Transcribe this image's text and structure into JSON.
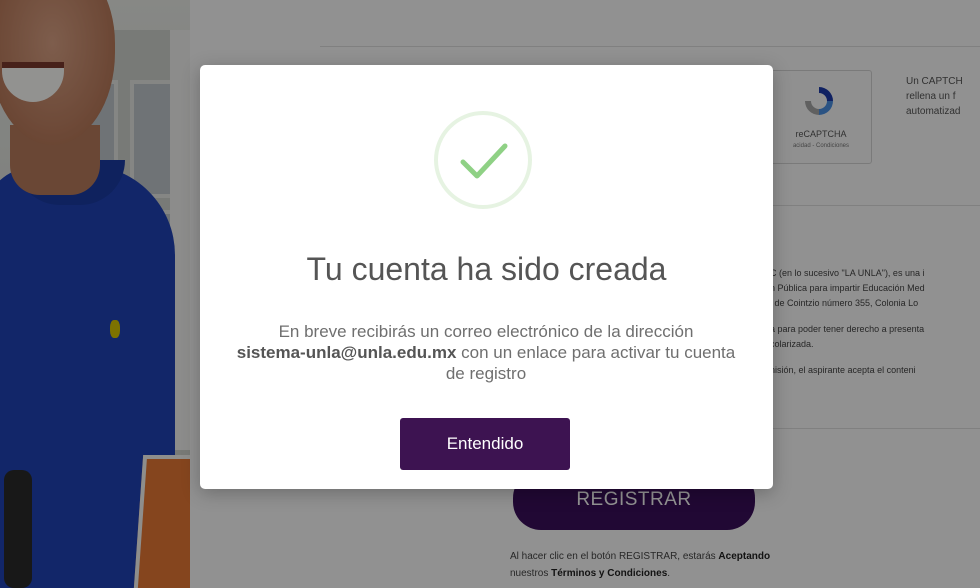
{
  "captcha": {
    "label": "reCAPTCHA",
    "sub": "acidad - Condiciones",
    "info_lines": [
      "Un CAPTCH",
      "rellena un f",
      "automatizad"
    ]
  },
  "legal": {
    "lines_1": [
      "C (en lo sucesivo \"LA UNLA\"), es una i",
      "n Pública para impartir Educación Med",
      "l de Cointzio número 355, Colonia Lo"
    ],
    "lines_2": [
      "a para poder tener derecho a presenta",
      "colarizada."
    ],
    "lines_3": [
      "nisión, el aspirante acepta el conteni"
    ]
  },
  "form": {
    "register_label": "REGISTRAR",
    "terms_prefix": "Al hacer clic en el botón REGISTRAR, estarás ",
    "terms_accept": "Aceptando",
    "terms_middle": "nuestros ",
    "terms_link": "Términos y Condiciones",
    "terms_suffix": "."
  },
  "modal": {
    "title": "Tu cuenta ha sido creada",
    "message_before": "En breve recibirás un correo electrónico de la dirección",
    "email": "sistema-unla@unla.edu.mx",
    "message_after": "con un enlace para activar tu cuenta de registro",
    "button_label": "Entendido",
    "icon": "check-icon",
    "accent_color": "#3d1351",
    "check_color": "#8fd185"
  }
}
